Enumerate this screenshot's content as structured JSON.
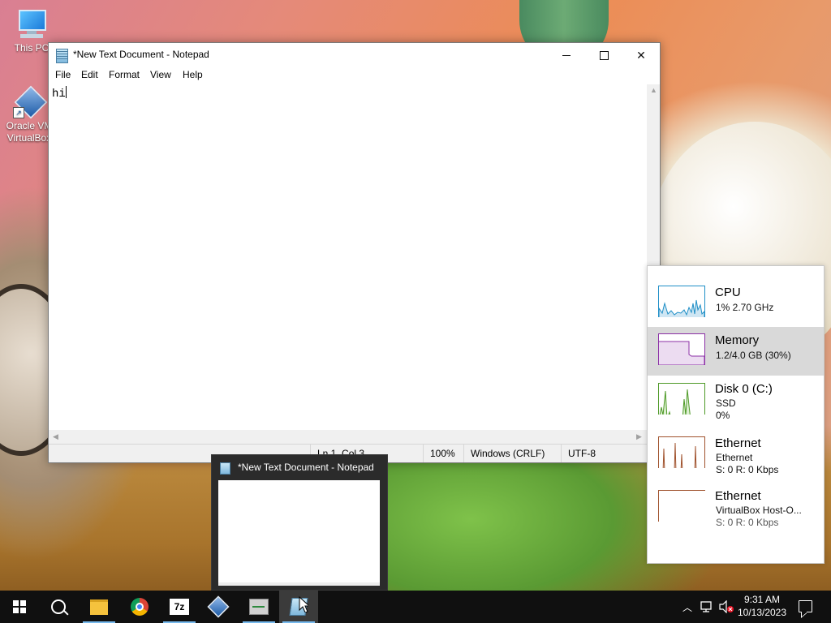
{
  "desktop": {
    "icons": [
      {
        "label": "This PC"
      },
      {
        "label_line1": "Oracle VM",
        "label_line2": "VirtualBox"
      }
    ]
  },
  "notepad": {
    "title": "*New Text Document - Notepad",
    "menu": [
      "File",
      "Edit",
      "Format",
      "View",
      "Help"
    ],
    "content": "hi",
    "status": {
      "position": "Ln 1, Col 3",
      "zoom": "100%",
      "line_endings": "Windows (CRLF)",
      "encoding": "UTF-8"
    }
  },
  "perf_panel": {
    "items": [
      {
        "name": "CPU",
        "line1": "1%  2.70 GHz",
        "line2": "",
        "color": "#1f8fc7",
        "selected": false
      },
      {
        "name": "Memory",
        "line1": "1.2/4.0 GB (30%)",
        "line2": "",
        "color": "#8b2fa6",
        "selected": true
      },
      {
        "name": "Disk 0 (C:)",
        "line1": "SSD",
        "line2": "0%",
        "color": "#4e9a27",
        "selected": false
      },
      {
        "name": "Ethernet",
        "line1": "Ethernet",
        "line2": "S: 0 R: 0 Kbps",
        "color": "#a0522d",
        "selected": false
      },
      {
        "name": "Ethernet",
        "line1": "VirtualBox Host-O...",
        "line2": "S: 0 R: 0 Kbps",
        "color": "#a0522d",
        "selected": false
      }
    ]
  },
  "thumbnail": {
    "title": "*New Text Document - Notepad"
  },
  "taskbar": {
    "apps": [
      "start-icon",
      "search-icon",
      "file-explorer-icon",
      "chrome-icon",
      "7zip-icon",
      "virtualbox-icon",
      "task-manager-icon",
      "notepad-icon"
    ],
    "sevenz_label": "7z",
    "time": "9:31 AM",
    "date": "10/13/2023"
  }
}
